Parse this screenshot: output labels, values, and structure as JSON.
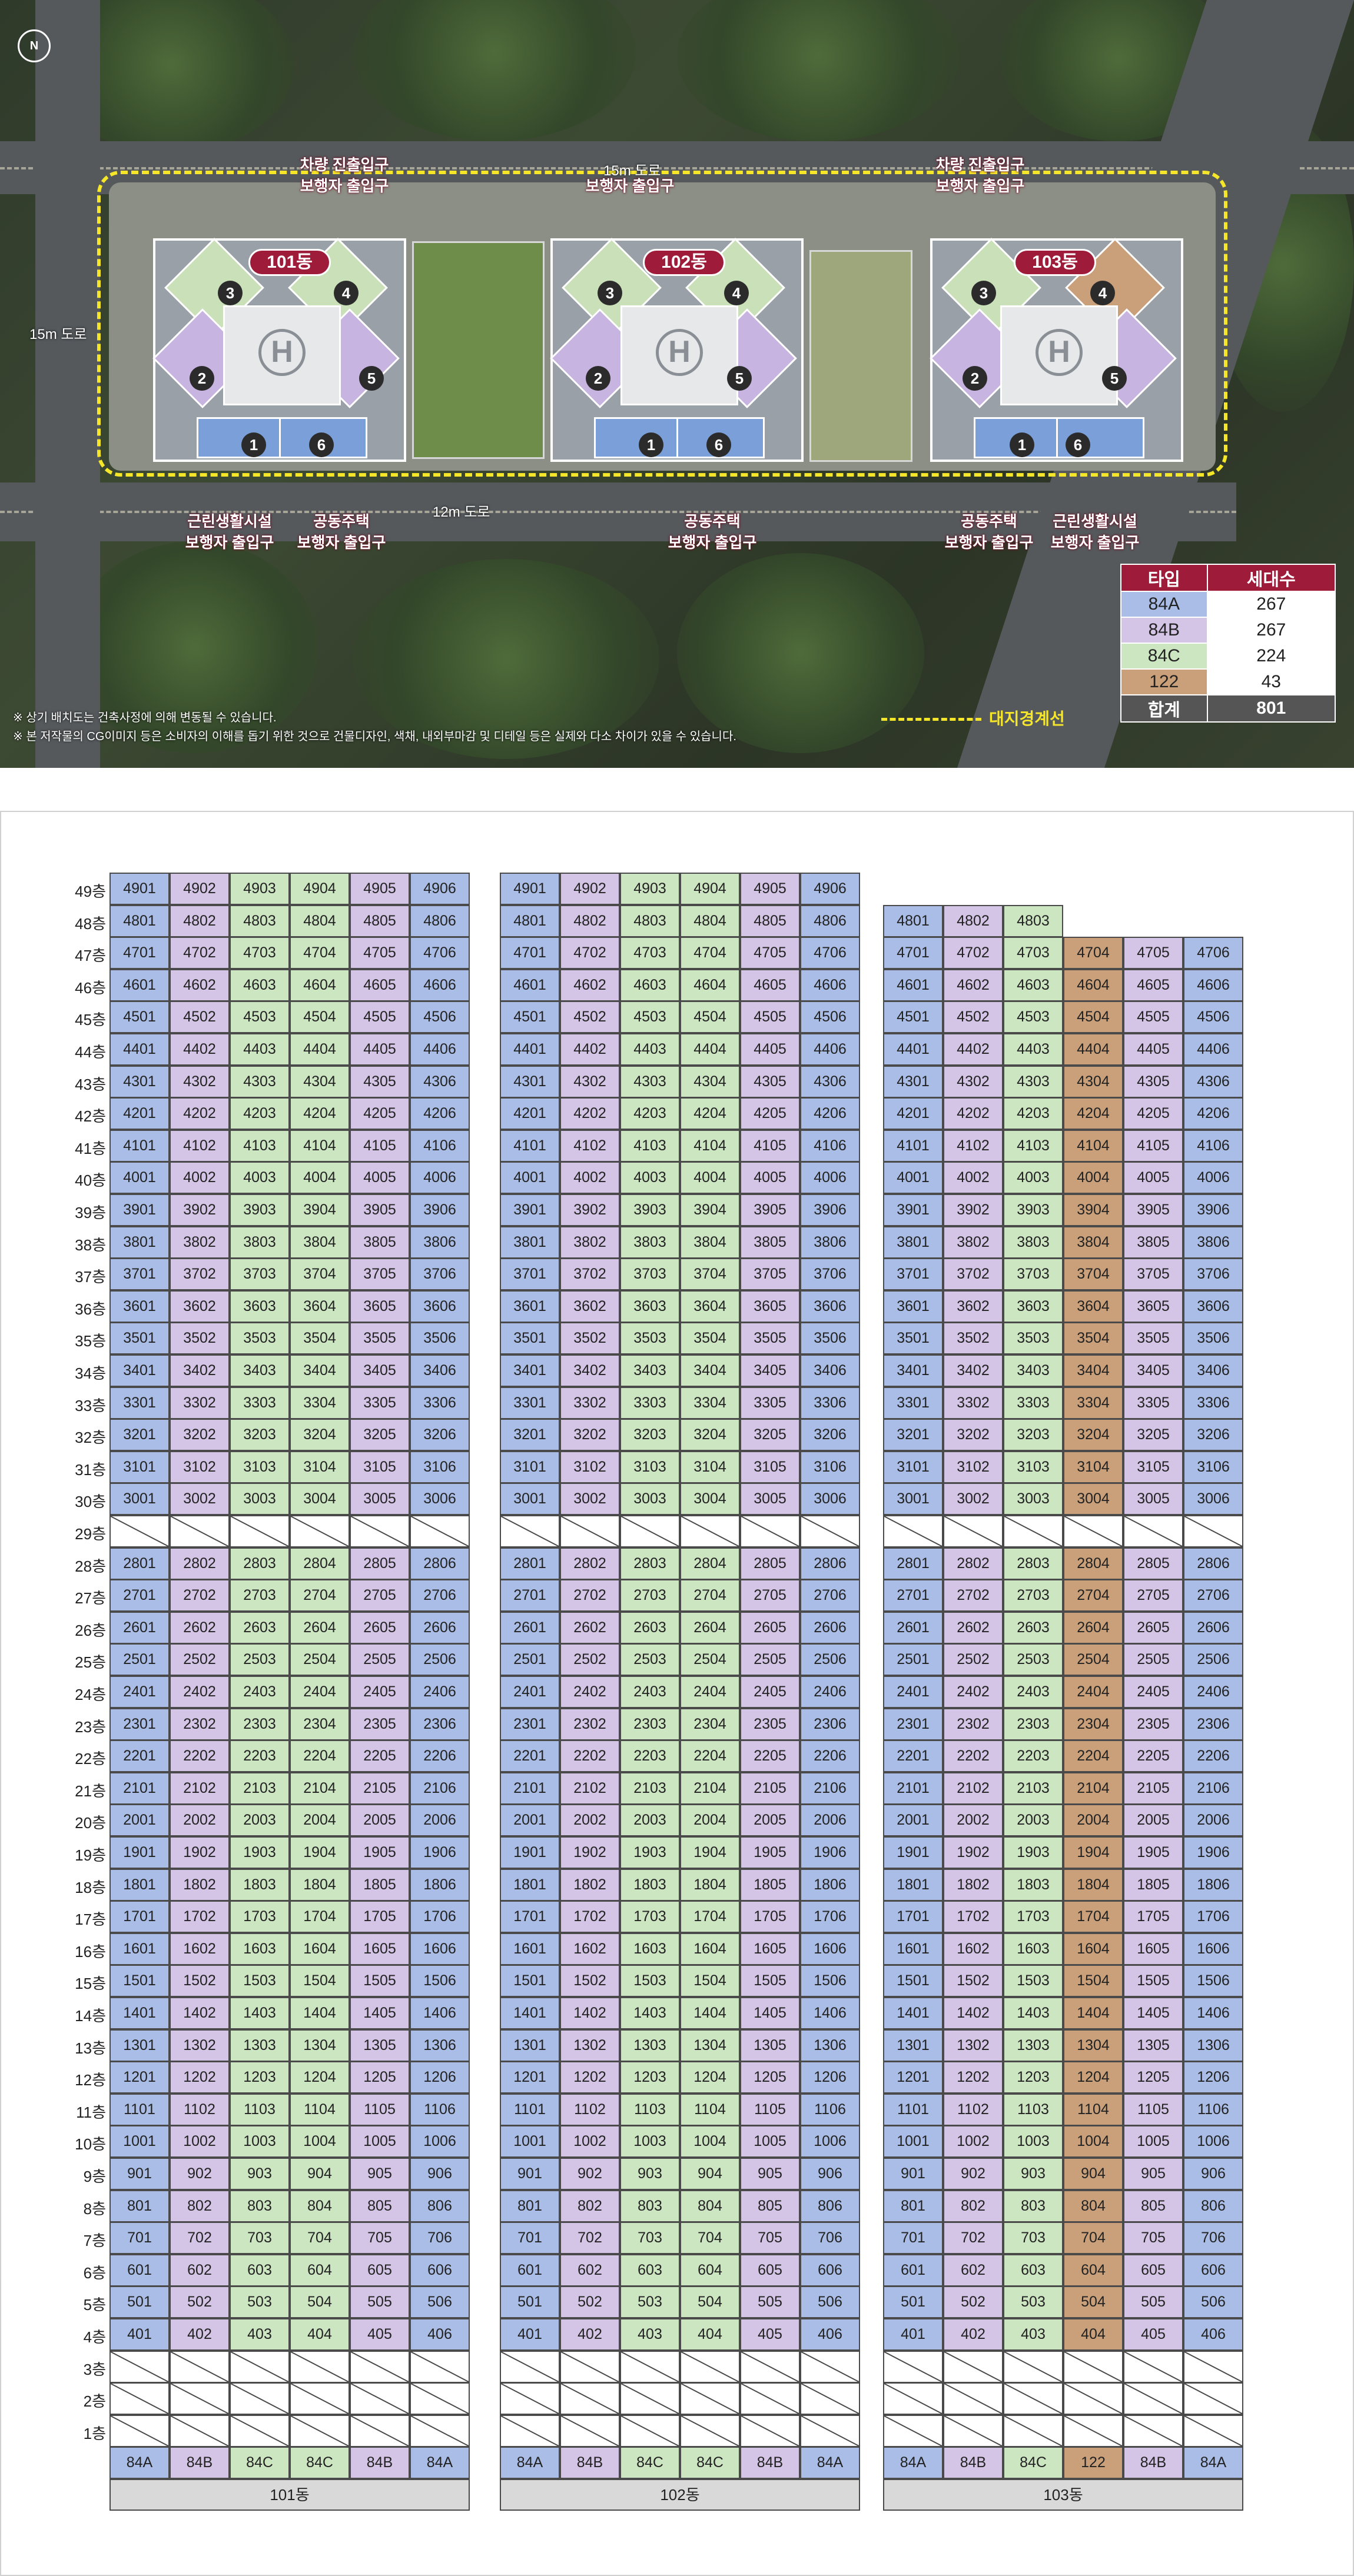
{
  "site_plan": {
    "compass": "N",
    "road_labels": [
      "15m 도로",
      "15m 도로",
      "12m 도로"
    ],
    "building_badges": [
      "101동",
      "102동",
      "103동"
    ],
    "wing_numbers": [
      "1",
      "2",
      "3",
      "4",
      "5",
      "6"
    ],
    "gates_top": [
      {
        "lines": [
          "차량 진출입구",
          "보행자 출입구"
        ]
      },
      {
        "lines": [
          "15m 도로",
          "보행자 출입구"
        ]
      },
      {
        "lines": [
          "차량 진출입구",
          "보행자 출입구"
        ]
      }
    ],
    "gates_bottom": [
      {
        "lines": [
          "근린생활시설",
          "보행자 출입구"
        ]
      },
      {
        "lines": [
          "공동주택",
          "보행자 출입구"
        ]
      },
      {
        "lines": [
          "공동주택",
          "보행자 출입구"
        ]
      },
      {
        "lines": [
          "공동주택",
          "보행자 출입구"
        ]
      },
      {
        "lines": [
          "근린생활시설",
          "보행자 출입구"
        ]
      }
    ],
    "notes": [
      "※ 상기 배치도는 건축사정에 의해 변동될 수 있습니다.",
      "※ 본 저작물의 CG이미지 등은 소비자의 이해를 돕기 위한 것으로 건물디자인, 색채, 내외부마감 및 디테일 등은 실제와 다소 차이가 있을 수 있습니다."
    ],
    "boundary_label": "대지경계선",
    "legend": {
      "headers": [
        "타입",
        "세대수"
      ],
      "rows": [
        {
          "type": "84A",
          "count": "267",
          "color": "#a9bde6"
        },
        {
          "type": "84B",
          "count": "267",
          "color": "#d4c4e6"
        },
        {
          "type": "84C",
          "count": "224",
          "color": "#cde6c2"
        },
        {
          "type": "122",
          "count": "43",
          "color": "#c9a07a"
        }
      ],
      "total": {
        "label": "합계",
        "count": "801"
      }
    }
  },
  "type_colors": {
    "84A": "#a9bde6",
    "84B": "#d4c4e6",
    "84C": "#cde6c2",
    "122": "#c9a07a"
  },
  "grid": {
    "floor_labels": [
      "49층",
      "48층",
      "47층",
      "46층",
      "45층",
      "44층",
      "43층",
      "42층",
      "41층",
      "40층",
      "39층",
      "38층",
      "37층",
      "36층",
      "35층",
      "34층",
      "33층",
      "32층",
      "31층",
      "30층",
      "29층",
      "28층",
      "27층",
      "26층",
      "25층",
      "24층",
      "23층",
      "22층",
      "21층",
      "20층",
      "19층",
      "18층",
      "17층",
      "16층",
      "15층",
      "14층",
      "13층",
      "12층",
      "11층",
      "10층",
      "9층",
      "8층",
      "7층",
      "6층",
      "5층",
      "4층",
      "3층",
      "2층",
      "1층"
    ],
    "buildings": [
      {
        "name": "101동",
        "line_types": [
          "84A",
          "84B",
          "84C",
          "84C",
          "84B",
          "84A"
        ],
        "top_floor": 49,
        "partial_top": null
      },
      {
        "name": "102동",
        "line_types": [
          "84A",
          "84B",
          "84C",
          "84C",
          "84B",
          "84A"
        ],
        "top_floor": 49,
        "partial_top": null
      },
      {
        "name": "103동",
        "line_types": [
          "84A",
          "84B",
          "84C",
          "122",
          "84B",
          "84A"
        ],
        "top_floor": 47,
        "partial_top": {
          "floor": 48,
          "lines": 3
        }
      }
    ],
    "skipped_floors": [
      29,
      3,
      2,
      1
    ]
  }
}
